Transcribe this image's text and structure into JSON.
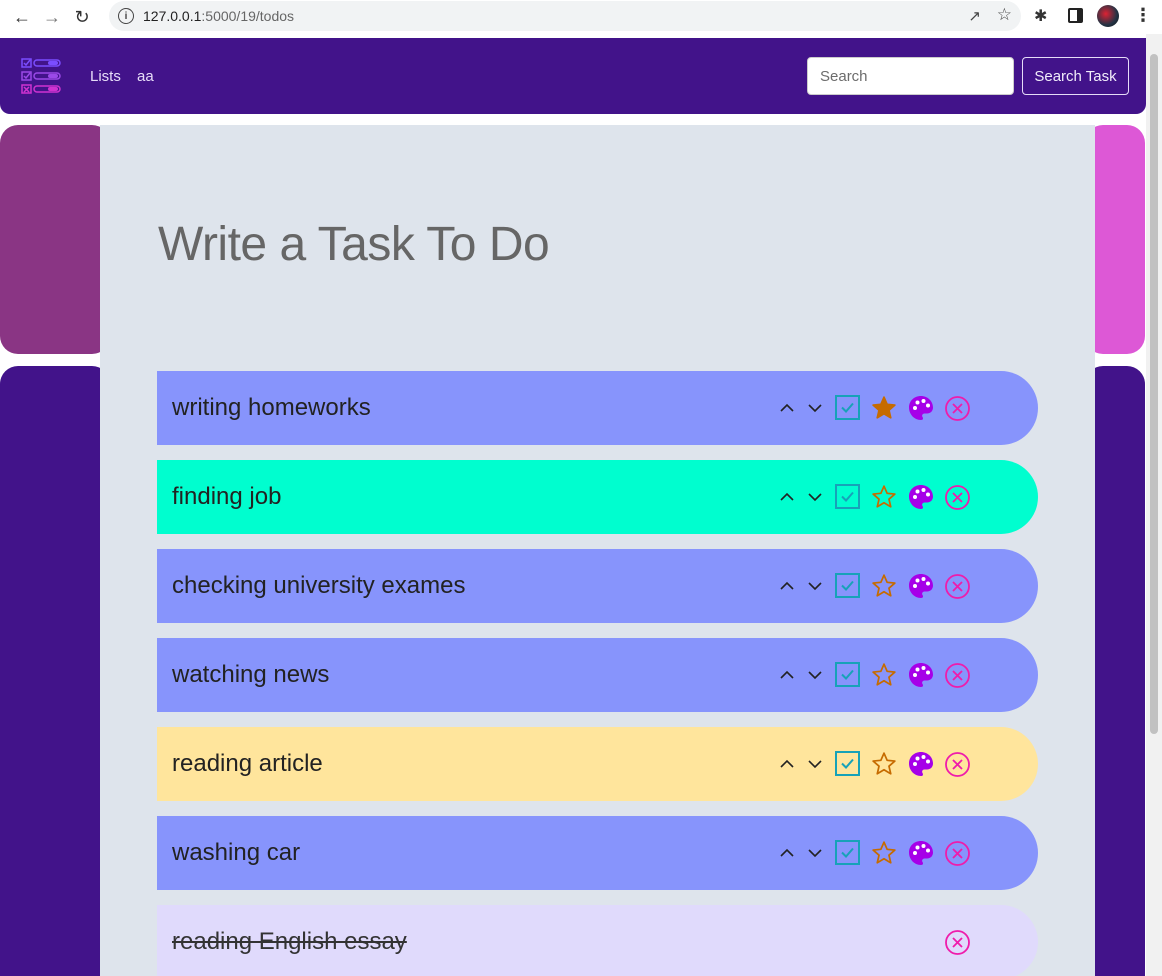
{
  "browser": {
    "url_host": "127.0.0.1",
    "url_rest": ":5000/19/todos"
  },
  "navbar": {
    "links": [
      "Lists",
      "aa"
    ],
    "search_placeholder": "Search",
    "search_button": "Search Task"
  },
  "heading": "Write a Task To Do",
  "tasks": [
    {
      "text": "writing homeworks",
      "color": "#8794fc",
      "starred": true,
      "done": false
    },
    {
      "text": "finding job",
      "color": "#00fecf",
      "starred": false,
      "done": false
    },
    {
      "text": "checking university exames",
      "color": "#8794fc",
      "starred": false,
      "done": false
    },
    {
      "text": "watching news",
      "color": "#8794fc",
      "starred": false,
      "done": false
    },
    {
      "text": "reading article",
      "color": "#ffe59c",
      "starred": false,
      "done": false
    },
    {
      "text": "washing car",
      "color": "#8794fc",
      "starred": false,
      "done": false
    },
    {
      "text": "reading English essay",
      "color": "#e0dafc",
      "starred": false,
      "done": true
    }
  ],
  "icons": {
    "up": "chevron-up-icon",
    "down": "chevron-down-icon",
    "check": "check-square-icon",
    "star": "star-icon",
    "palette": "palette-icon",
    "close": "close-circle-icon"
  },
  "colors": {
    "navbar": "#42138a",
    "main_bg": "#dee4ec",
    "check": "#17a2b8",
    "star": "#c66b00",
    "palette": "#a600e8",
    "close": "#ef1cab"
  }
}
